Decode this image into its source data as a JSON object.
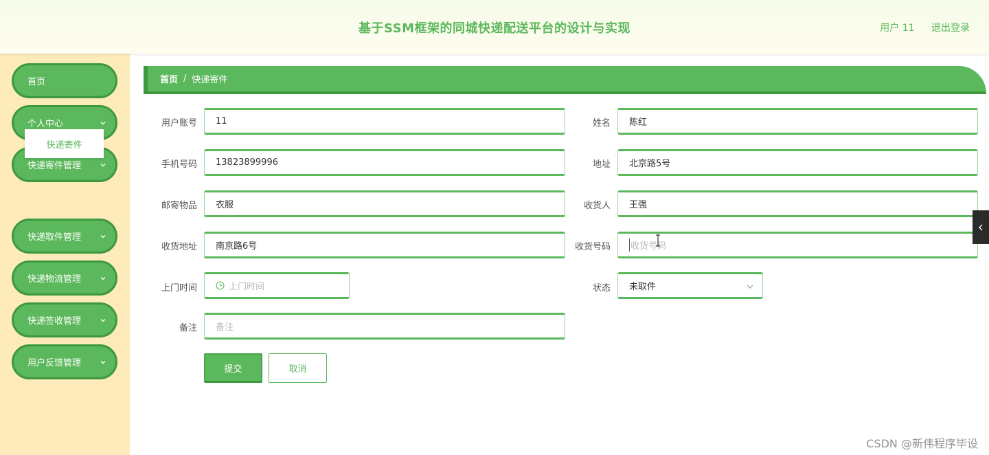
{
  "header": {
    "title": "基于SSM框架的同城快递配送平台的设计与实现",
    "user_label": "用户 11",
    "logout_label": "退出登录"
  },
  "sidebar": {
    "items": [
      {
        "label": "首页"
      },
      {
        "label": "个人中心"
      },
      {
        "label": "快递寄件管理"
      },
      {
        "label": "快递取件管理"
      },
      {
        "label": "快递物流管理"
      },
      {
        "label": "快递签收管理"
      },
      {
        "label": "用户反馈管理"
      }
    ],
    "submenu_active": "快递寄件"
  },
  "breadcrumb": {
    "home": "首页",
    "separator": "/",
    "current": "快递寄件"
  },
  "form": {
    "account": {
      "label": "用户账号",
      "value": "11"
    },
    "name": {
      "label": "姓名",
      "value": "陈红"
    },
    "phone": {
      "label": "手机号码",
      "value": "13823899996"
    },
    "address": {
      "label": "地址",
      "value": "北京路5号"
    },
    "item": {
      "label": "邮寄物品",
      "value": "衣服"
    },
    "receiver": {
      "label": "收货人",
      "value": "王强"
    },
    "receiver_address": {
      "label": "收货地址",
      "value": "南京路6号"
    },
    "receiver_phone": {
      "label": "收货号码",
      "placeholder": "收货号码"
    },
    "pickup_time": {
      "label": "上门时间",
      "placeholder": "上门时间"
    },
    "status": {
      "label": "状态",
      "value": "未取件"
    },
    "remark": {
      "label": "备注",
      "placeholder": "备注"
    },
    "submit_label": "提交",
    "cancel_label": "取消"
  },
  "watermark": "CSDN @新伟程序毕设",
  "colors": {
    "primary": "#5cb85c",
    "primary_dark": "#3e993e",
    "sidebar_bg": "#fdebbb"
  },
  "icons": {
    "chevron": "chevron-down-icon",
    "clock": "clock-icon",
    "collapse": "chevron-left-icon"
  }
}
